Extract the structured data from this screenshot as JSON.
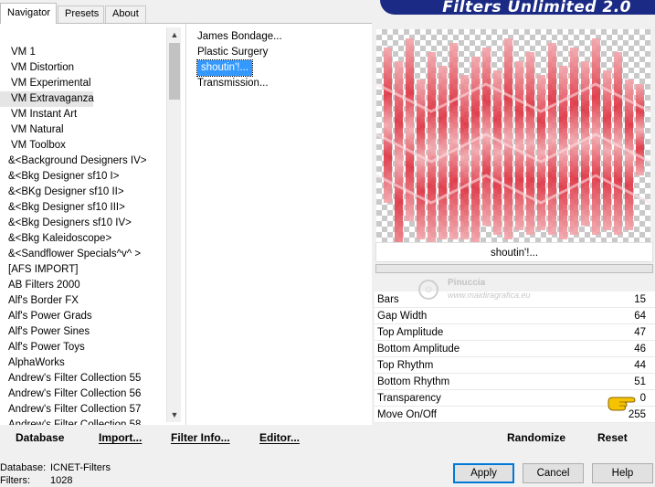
{
  "window": {
    "banner_title": "Filters Unlimited 2.0"
  },
  "tabs": [
    {
      "label": "Navigator",
      "active": true
    },
    {
      "label": "Presets",
      "active": false
    },
    {
      "label": "About",
      "active": false
    }
  ],
  "categories": [
    "VM 1",
    "VM Distortion",
    "VM Experimental",
    "VM Extravaganza",
    "VM Instant Art",
    "VM Natural",
    "VM Toolbox",
    "&<Background Designers IV>",
    "&<Bkg Designer sf10 I>",
    "&<BKg Designer sf10 II>",
    "&<Bkg Designer sf10 III>",
    "&<Bkg Designers sf10 IV>",
    "&<Bkg Kaleidoscope>",
    "&<Sandflower Specials^v^ >",
    "[AFS IMPORT]",
    "AB Filters 2000",
    "Alf's Border FX",
    "Alf's Power Grads",
    "Alf's Power Sines",
    "Alf's Power Toys",
    "AlphaWorks",
    "Andrew's Filter Collection 55",
    "Andrew's Filter Collection 56",
    "Andrew's Filter Collection 57",
    "Andrew's Filter Collection 58"
  ],
  "selected_category": "VM Extravaganza",
  "filters": [
    "James Bondage...",
    "Plastic Surgery",
    "shoutin'!...",
    "Transmission..."
  ],
  "selected_filter": "shoutin'!...",
  "preview": {
    "preset_name": "shoutin'!...",
    "colors": {
      "pink_dark": "#e0303f",
      "pink_light": "#f3a7ad"
    }
  },
  "parameters": [
    {
      "name": "Bars",
      "value": "15"
    },
    {
      "name": "Gap Width",
      "value": "64"
    },
    {
      "name": "Top Amplitude",
      "value": "47"
    },
    {
      "name": "Bottom Amplitude",
      "value": "46"
    },
    {
      "name": "Top Rhythm",
      "value": "44"
    },
    {
      "name": "Bottom Rhythm",
      "value": "51"
    },
    {
      "name": "Transparency",
      "value": "0"
    },
    {
      "name": "Move On/Off",
      "value": "255"
    }
  ],
  "watermark": {
    "name": "Pinuccia",
    "url": "www.maidiragrafica.eu"
  },
  "toolbar": {
    "database": "Database",
    "import": "Import...",
    "filter_info": "Filter Info...",
    "editor": "Editor...",
    "randomize": "Randomize",
    "reset": "Reset"
  },
  "status": {
    "database_label": "Database:",
    "database_value": "ICNET-Filters",
    "filters_label": "Filters:",
    "filters_value": "1028"
  },
  "buttons": {
    "apply": "Apply",
    "cancel": "Cancel",
    "help": "Help"
  },
  "icons": {
    "scroll_up": "up-arrow-icon",
    "scroll_down": "down-arrow-icon",
    "pointer": "pointing-hand-icon"
  }
}
